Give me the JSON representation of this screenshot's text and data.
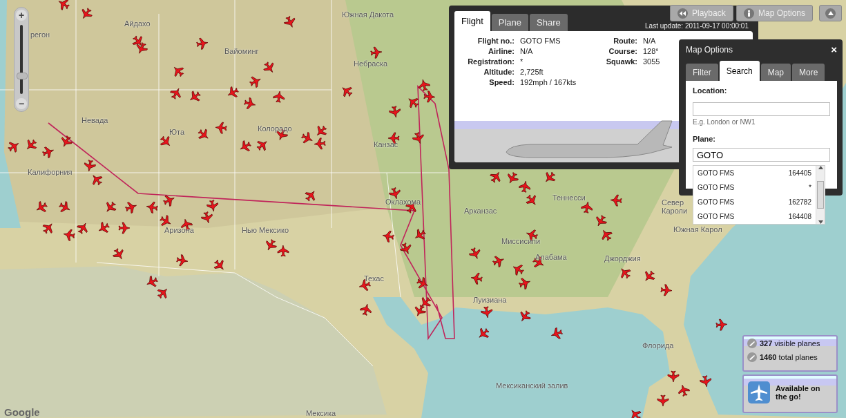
{
  "zoom_control": {
    "zoom_in": "+",
    "zoom_out": "−",
    "level": 0.25
  },
  "map_labels": [
    "регон",
    "Айдахо",
    "Вайоминг",
    "Южная Дакота",
    "Небраска",
    "Невада",
    "Юта",
    "Колорадо",
    "Канзас",
    "Калифорния",
    "Оклахома",
    "Аризона",
    "Нью Мексико",
    "Техас",
    "Арканзас",
    "Теннесси",
    "Север",
    "Кароли",
    "Миссисипи",
    "Алабама",
    "Южная Карол",
    "Джорджия",
    "Луизиана",
    "Флорида",
    "Мексиканский залив",
    "Мексика"
  ],
  "google_logo": "Google",
  "toolbar": {
    "playback": "Playback",
    "map_options": "Map Options"
  },
  "flight_panel": {
    "tabs": [
      {
        "label": "Flight",
        "selected": true
      },
      {
        "label": "Plane",
        "selected": false
      },
      {
        "label": "Share",
        "selected": false
      }
    ],
    "last_update_label": "Last update:",
    "last_update_value": "2011-09-17 00:00:01",
    "fields_left": [
      {
        "label": "Flight no.:",
        "value": "GOTO FMS"
      },
      {
        "label": "Airline:",
        "value": "N/A"
      },
      {
        "label": "Registration:",
        "value": "*"
      },
      {
        "label": "Altitude:",
        "value": "2,725ft"
      },
      {
        "label": "Speed:",
        "value": "192mph / 167kts"
      }
    ],
    "fields_right": [
      {
        "label": "Route:",
        "value": "N/A"
      },
      {
        "label": "Course:",
        "value": "128°"
      },
      {
        "label": "Squawk:",
        "value": "3055"
      }
    ]
  },
  "map_options": {
    "title": "Map Options",
    "close": "×",
    "tabs": [
      {
        "label": "Filter",
        "selected": false
      },
      {
        "label": "Search",
        "selected": true
      },
      {
        "label": "Map",
        "selected": false
      },
      {
        "label": "More",
        "selected": false
      }
    ],
    "location_label": "Location:",
    "location_hint": "E.g. London or NW1",
    "plane_label": "Plane:",
    "plane_value": "GOTO ",
    "results": [
      {
        "name": "GOTO FMS",
        "id": "164405"
      },
      {
        "name": "GOTO FMS",
        "id": "*"
      },
      {
        "name": "GOTO FMS",
        "id": "162782"
      },
      {
        "name": "GOTO FMS",
        "id": "164408"
      }
    ]
  },
  "stats": {
    "visible_count": "327",
    "visible_label": "visible planes",
    "total_count": "1460",
    "total_label": "total planes"
  },
  "promo": "Available on the go!"
}
